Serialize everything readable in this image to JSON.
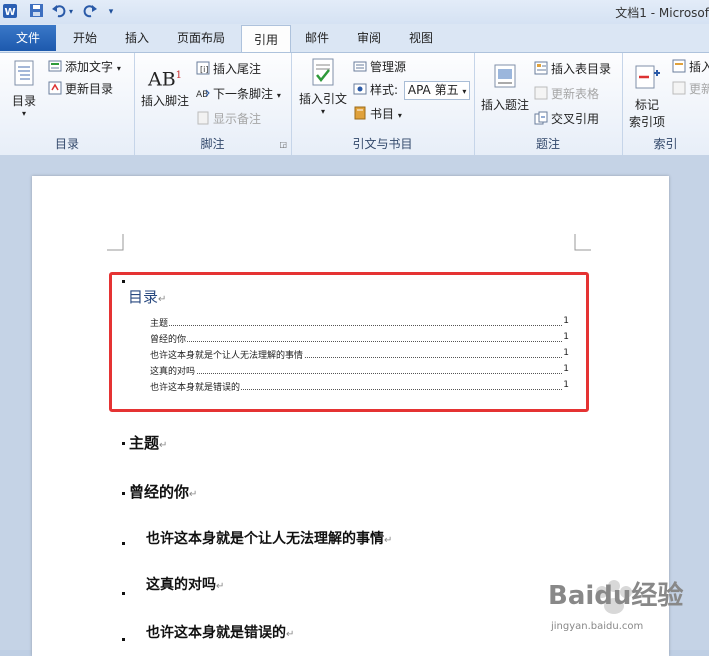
{
  "window": {
    "title": "文档1 - Microsof",
    "quick_access": [
      "word-app-icon",
      "save-icon",
      "undo-icon",
      "dropdown-icon",
      "redo-icon",
      "customize-icon"
    ]
  },
  "tabs": [
    {
      "label": "文件",
      "name": "tab-file"
    },
    {
      "label": "开始",
      "name": "tab-home"
    },
    {
      "label": "插入",
      "name": "tab-insert"
    },
    {
      "label": "页面布局",
      "name": "tab-page-layout"
    },
    {
      "label": "引用",
      "name": "tab-references",
      "active": true
    },
    {
      "label": "邮件",
      "name": "tab-mailings"
    },
    {
      "label": "审阅",
      "name": "tab-review"
    },
    {
      "label": "视图",
      "name": "tab-view"
    }
  ],
  "ribbon": {
    "toc": {
      "group_label": "目录",
      "toc_button": "目录",
      "add_text": "添加文字",
      "update_toc": "更新目录"
    },
    "footnotes": {
      "group_label": "脚注",
      "insert_footnote": "插入脚注",
      "insert_endnote": "插入尾注",
      "next_footnote": "下一条脚注",
      "show_notes": "显示备注",
      "ab_text": "AB"
    },
    "citations": {
      "group_label": "引文与书目",
      "insert_citation": "插入引文",
      "manage_sources": "管理源",
      "style_label": "样式:",
      "style_value": "APA 第五",
      "bibliography": "书目"
    },
    "captions": {
      "group_label": "题注",
      "insert_caption": "插入题注",
      "insert_table_of_figures": "插入表目录",
      "update_table": "更新表格",
      "cross_reference": "交叉引用"
    },
    "index": {
      "group_label": "索引",
      "mark_entry_line1": "标记",
      "mark_entry_line2": "索引项",
      "insert_index": "插入",
      "update_index": "更新"
    }
  },
  "document": {
    "toc_title": "目录",
    "toc_entries": [
      {
        "text": "主题",
        "page": "1"
      },
      {
        "text": "曾经的你",
        "page": "1"
      },
      {
        "text": "也许这本身就是个让人无法理解的事情",
        "page": "1"
      },
      {
        "text": "这真的对吗",
        "page": "1"
      },
      {
        "text": "也许这本身就是错误的",
        "page": "1"
      }
    ],
    "headings": [
      {
        "text": "主题",
        "level": 1
      },
      {
        "text": "曾经的你",
        "level": 1
      },
      {
        "text": "也许这本身就是个让人无法理解的事情",
        "level": 2
      },
      {
        "text": "这真的对吗",
        "level": 2
      },
      {
        "text": "也许这本身就是错误的",
        "level": 2
      }
    ],
    "paragraph_mark": "↵"
  },
  "watermark": {
    "brand": "Baidu经验",
    "url": "jingyan.baidu.com"
  },
  "colors": {
    "highlight_border": "#e53333",
    "file_tab": "#2a66b8",
    "toc_title": "#2a4a80"
  }
}
